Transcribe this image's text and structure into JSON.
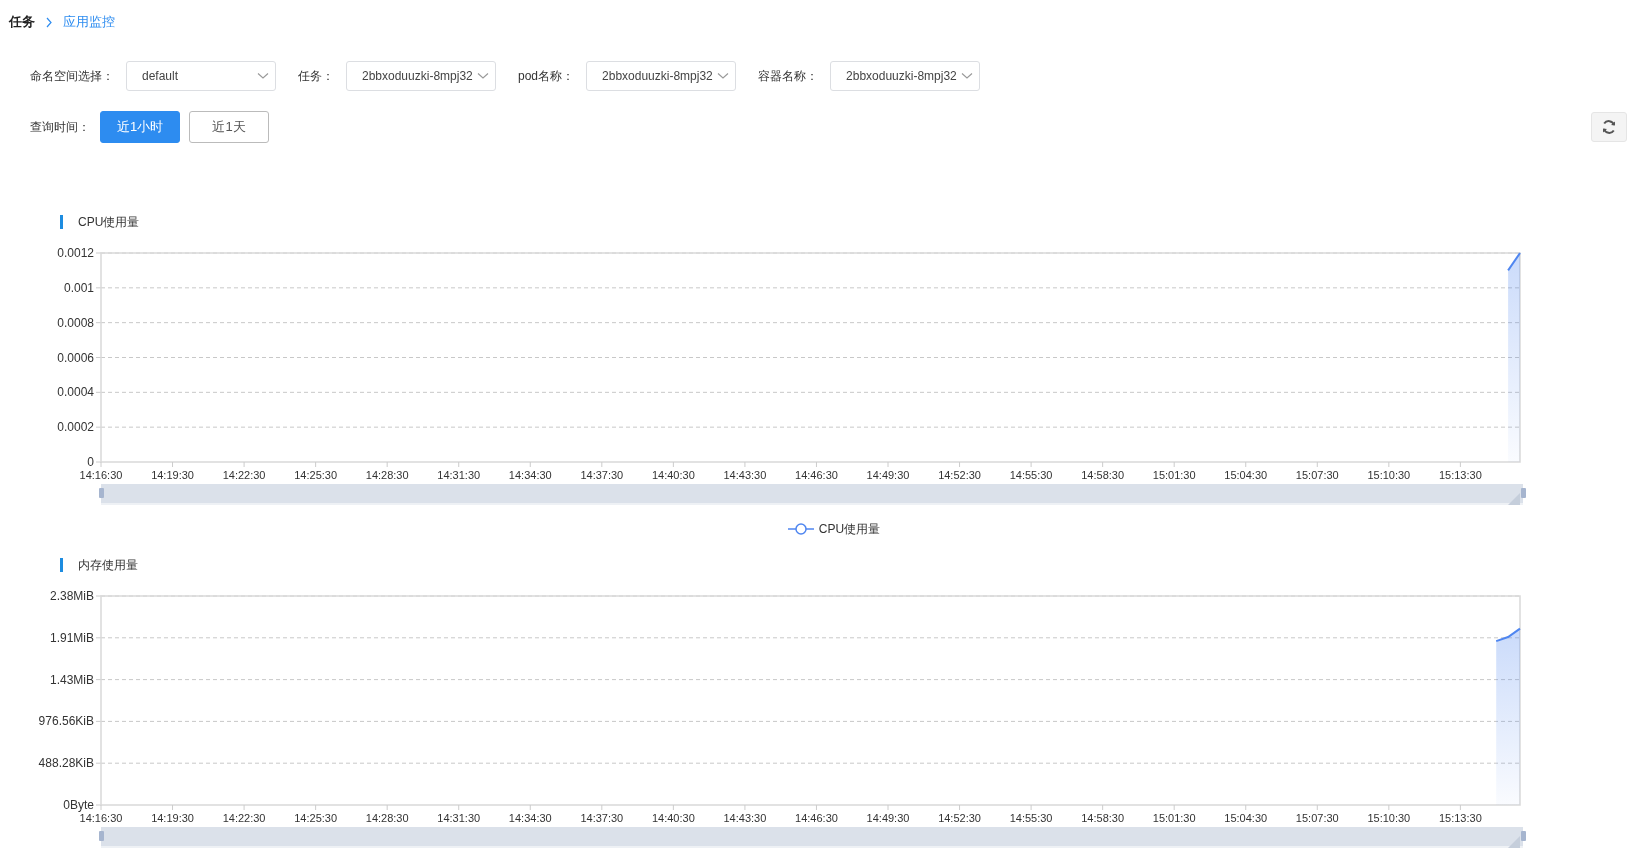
{
  "breadcrumb": [
    {
      "label": "任务",
      "current": false
    },
    {
      "label": "应用监控",
      "current": true
    }
  ],
  "filters": [
    {
      "label": "命名空间选择：",
      "value": "default"
    },
    {
      "label": "任务：",
      "value": "2bbxoduuzki-8mpj32"
    },
    {
      "label": "pod名称：",
      "value": "2bbxoduuzki-8mpj32"
    },
    {
      "label": "容器名称：",
      "value": "2bbxoduuzki-8mpj32"
    }
  ],
  "time_range": {
    "label": "查询时间：",
    "options": [
      {
        "label": "近1小时",
        "selected": true
      },
      {
        "label": "近1天",
        "selected": false
      }
    ]
  },
  "charts": [
    {
      "title": "CPU使用量",
      "zoom_slider": {
        "level": 1
      },
      "chart_data": {
        "type": "area",
        "categories": [
          "14:16:30",
          null,
          null,
          null,
          null,
          null,
          "14:19:30",
          null,
          null,
          null,
          null,
          null,
          "14:22:30",
          null,
          null,
          null,
          null,
          null,
          "14:25:30",
          null,
          null,
          null,
          null,
          null,
          "14:28:30",
          null,
          null,
          null,
          null,
          null,
          "14:31:30",
          null,
          null,
          null,
          null,
          null,
          "14:34:30",
          null,
          null,
          null,
          null,
          null,
          "14:37:30",
          null,
          null,
          null,
          null,
          null,
          "14:40:30",
          null,
          null,
          null,
          null,
          null,
          "14:43:30",
          null,
          null,
          null,
          null,
          null,
          "14:46:30",
          null,
          null,
          null,
          null,
          null,
          "14:49:30",
          null,
          null,
          null,
          null,
          null,
          "14:52:30",
          null,
          null,
          null,
          null,
          null,
          "14:55:30",
          null,
          null,
          null,
          null,
          null,
          "14:58:30",
          null,
          null,
          null,
          null,
          null,
          "15:01:30",
          null,
          null,
          null,
          null,
          null,
          "15:04:30",
          null,
          null,
          null,
          null,
          null,
          "15:07:30",
          null,
          null,
          null,
          null,
          null,
          "15:10:30",
          null,
          null,
          null,
          null,
          null,
          "15:13:30",
          null,
          null,
          null,
          null,
          null
        ],
        "series": [
          {
            "name": "CPU使用量",
            "color": "#4f86f0",
            "values": [
              null,
              null,
              null,
              null,
              null,
              null,
              null,
              null,
              null,
              null,
              null,
              null,
              null,
              null,
              null,
              null,
              null,
              null,
              null,
              null,
              null,
              null,
              null,
              null,
              null,
              null,
              null,
              null,
              null,
              null,
              null,
              null,
              null,
              null,
              null,
              null,
              null,
              null,
              null,
              null,
              null,
              null,
              null,
              null,
              null,
              null,
              null,
              null,
              null,
              null,
              null,
              null,
              null,
              null,
              null,
              null,
              null,
              null,
              null,
              null,
              null,
              null,
              null,
              null,
              null,
              null,
              null,
              null,
              null,
              null,
              null,
              null,
              null,
              null,
              null,
              null,
              null,
              null,
              null,
              null,
              null,
              null,
              null,
              null,
              null,
              null,
              null,
              null,
              null,
              null,
              null,
              null,
              null,
              null,
              null,
              null,
              null,
              null,
              null,
              null,
              null,
              null,
              null,
              null,
              null,
              null,
              null,
              null,
              null,
              null,
              null,
              null,
              null,
              null,
              null,
              null,
              null,
              null,
              0.0011,
              0.0012
            ]
          }
        ],
        "grid": true,
        "ylim": [
          0,
          0.0012
        ],
        "yticks": [
          0,
          0.0002,
          0.0004,
          0.0006,
          0.0008,
          0.001,
          0.0012
        ]
      }
    },
    {
      "title": "内存使用量",
      "zoom_slider": {
        "level": 1
      },
      "plot": {
        "x_labels": [
          "14:16:30",
          "14:19:30",
          "14:22:30",
          "14:25:30",
          "14:28:30",
          "14:31:30",
          "14:34:30",
          "14:37:30",
          "14:40:30",
          "14:43:30",
          "14:46:30",
          "14:49:30",
          "14:52:30",
          "14:55:30",
          "14:58:30",
          "15:01:30",
          "15:04:30",
          "15:07:30",
          "15:10:30",
          "15:13:30"
        ],
        "y_labels": [
          "2.38MiB",
          "1.91MiB",
          "1.43MiB",
          "976.56KiB",
          "488.28KiB",
          "0Byte"
        ]
      }
    }
  ]
}
